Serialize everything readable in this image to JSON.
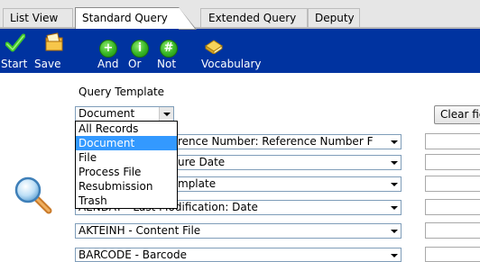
{
  "tabs": [
    {
      "label": "List View",
      "active": false
    },
    {
      "label": "Standard Query",
      "active": true
    },
    {
      "label": "Extended Query",
      "active": false
    },
    {
      "label": "Deputy",
      "active": false
    }
  ],
  "toolbar": {
    "background": "#0033a0",
    "items": [
      {
        "label": "Start",
        "icon": "checkmark-icon"
      },
      {
        "label": "Save",
        "icon": "save-folder-icon"
      },
      {
        "label": "And",
        "icon": "plus-icon",
        "glyph": "+"
      },
      {
        "label": "Or",
        "icon": "or-icon",
        "glyph": "i"
      },
      {
        "label": "Not",
        "icon": "hash-icon",
        "glyph": "#"
      },
      {
        "label": "Vocabulary",
        "icon": "book-icon"
      }
    ]
  },
  "query_template": {
    "label": "Query Template",
    "selected": "Document",
    "options": [
      "All Records",
      "Document",
      "File",
      "Process File",
      "Resubmission",
      "Trash"
    ],
    "highlighted_index": 1
  },
  "clear_button": "Clear fie",
  "fields": [
    {
      "value": "rence Number: Reference Number F"
    },
    {
      "value": "ure Date"
    },
    {
      "value": "mplate"
    },
    {
      "value": "AENDAT - Last Modification: Date"
    },
    {
      "value": "AKTEINH - Content File"
    },
    {
      "value": "BARCODE - Barcode"
    }
  ],
  "colors": {
    "accent": "#0033a0",
    "selection": "#3399ff"
  }
}
